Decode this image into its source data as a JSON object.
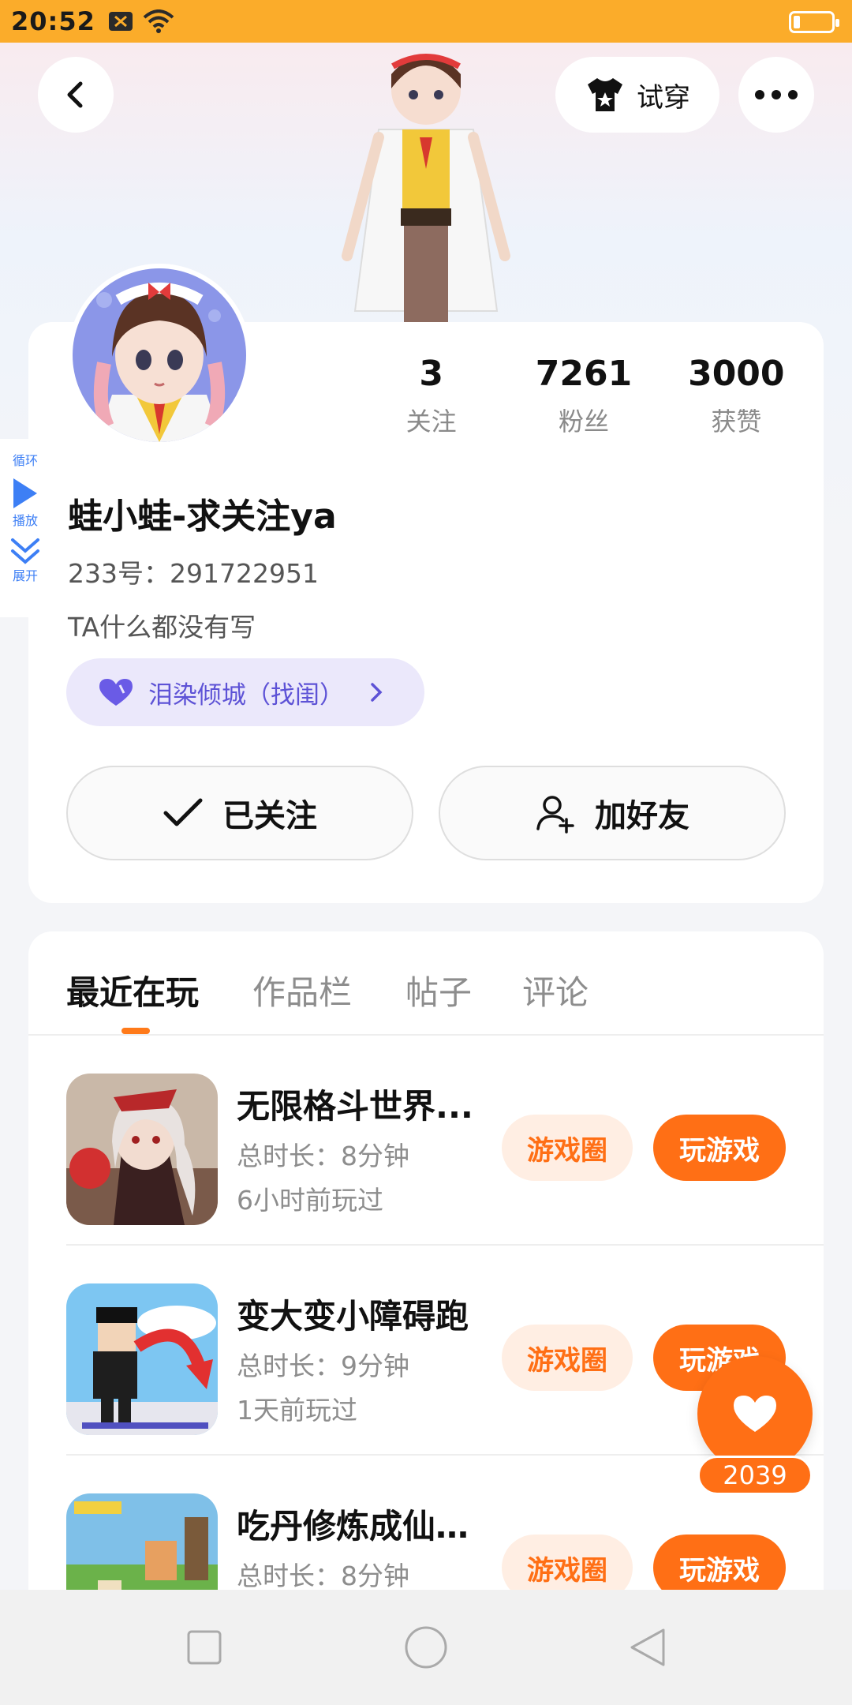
{
  "status_bar": {
    "time": "20:52"
  },
  "header": {
    "try_on_label": "试穿"
  },
  "profile": {
    "stats": [
      {
        "value": "3",
        "label": "关注"
      },
      {
        "value": "7261",
        "label": "粉丝"
      },
      {
        "value": "3000",
        "label": "获赞"
      }
    ],
    "side_float": {
      "loop": "循环",
      "play": "播放",
      "expand": "展开"
    },
    "nickname": "蛙小蛙-求关注ya",
    "uid": "233号：291722951",
    "bio": "TA什么都没有写",
    "guild": "泪染倾城（找闺）",
    "follow_label": "已关注",
    "add_friend_label": "加好友"
  },
  "tabs": [
    "最近在玩",
    "作品栏",
    "帖子",
    "评论"
  ],
  "games": [
    {
      "title": "无限格斗世界...",
      "time": "总时长：8分钟",
      "ago": "6小时前玩过",
      "circle": "游戏圈",
      "play": "玩游戏"
    },
    {
      "title": "变大变小障碍跑",
      "time": "总时长：9分钟",
      "ago": "1天前玩过",
      "circle": "游戏圈",
      "play": "玩游戏"
    },
    {
      "title": "吃丹修炼成仙-...",
      "time": "总时长：8分钟",
      "ago": "",
      "circle": "游戏圈",
      "play": "玩游戏"
    }
  ],
  "like": {
    "count": "2039"
  },
  "colors": {
    "status_bar": "#fbac2a",
    "accent": "#ff6f15",
    "guild": "#5d52d6"
  }
}
